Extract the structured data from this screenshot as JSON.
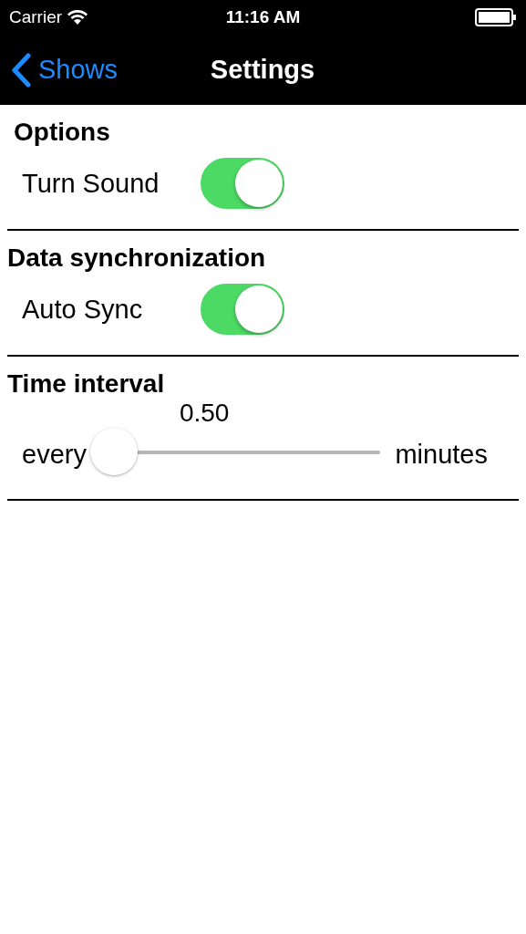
{
  "status_bar": {
    "carrier": "Carrier",
    "time": "11:16 AM"
  },
  "nav_bar": {
    "back": "Shows",
    "title": "Settings"
  },
  "sections": [
    {
      "title": "Options",
      "indent": true,
      "rows": [
        {
          "kind": "switch",
          "label": "Turn Sound",
          "on": true
        }
      ]
    },
    {
      "title": "Data synchronization",
      "indent": false,
      "rows": [
        {
          "kind": "switch",
          "label": "Auto Sync",
          "on": true
        }
      ]
    },
    {
      "title": "Time interval",
      "indent": false,
      "rows": [
        {
          "kind": "slider",
          "prefix": "every",
          "value": "0.50",
          "suffix": "minutes",
          "level": 0
        }
      ]
    }
  ]
}
